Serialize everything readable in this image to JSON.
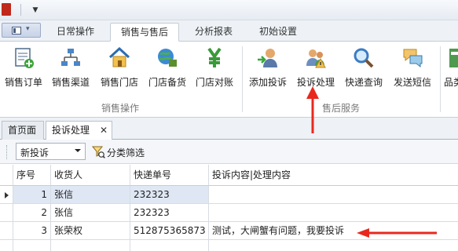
{
  "ribbon_tabs": [
    {
      "label": "日常操作"
    },
    {
      "label": "销售与售后",
      "active": true
    },
    {
      "label": "分析报表"
    },
    {
      "label": "初始设置"
    }
  ],
  "groups": {
    "sales": {
      "label": "销售操作",
      "buttons": [
        {
          "label": "销售订单",
          "icon": "sales-order-icon"
        },
        {
          "label": "销售渠道",
          "icon": "sales-channel-icon"
        },
        {
          "label": "销售门店",
          "icon": "store-icon"
        },
        {
          "label": "门店备货",
          "icon": "store-stock-icon"
        },
        {
          "label": "门店对账",
          "icon": "store-reconcile-icon"
        }
      ]
    },
    "aftersales": {
      "label": "售后服务",
      "buttons": [
        {
          "label": "添加投诉",
          "icon": "add-complaint-icon"
        },
        {
          "label": "投诉处理",
          "icon": "complaint-handling-icon"
        },
        {
          "label": "快递查询",
          "icon": "express-search-icon"
        },
        {
          "label": "发送短信",
          "icon": "send-sms-icon"
        },
        {
          "label": "品类",
          "icon": "category-icon"
        }
      ]
    }
  },
  "doc_tabs": [
    {
      "label": "首页面"
    },
    {
      "label": "投诉处理",
      "active": true
    }
  ],
  "toolbar": {
    "combo_value": "新投诉",
    "filter_label": "分类筛选"
  },
  "grid": {
    "columns": [
      "序号",
      "收货人",
      "快递单号",
      "投诉内容|处理内容"
    ],
    "rows": [
      {
        "seq": "1",
        "receiver": "张信",
        "tracking": "232323",
        "content": ""
      },
      {
        "seq": "2",
        "receiver": "张信",
        "tracking": "232323",
        "content": ""
      },
      {
        "seq": "3",
        "receiver": "张荣权",
        "tracking": "512875365873",
        "content": "测试，大闸蟹有问题，我要投诉"
      }
    ]
  },
  "colors": {
    "accent": "#1a6fc4",
    "annotation": "#e8281e",
    "selected_row": "#dfe7f4"
  }
}
